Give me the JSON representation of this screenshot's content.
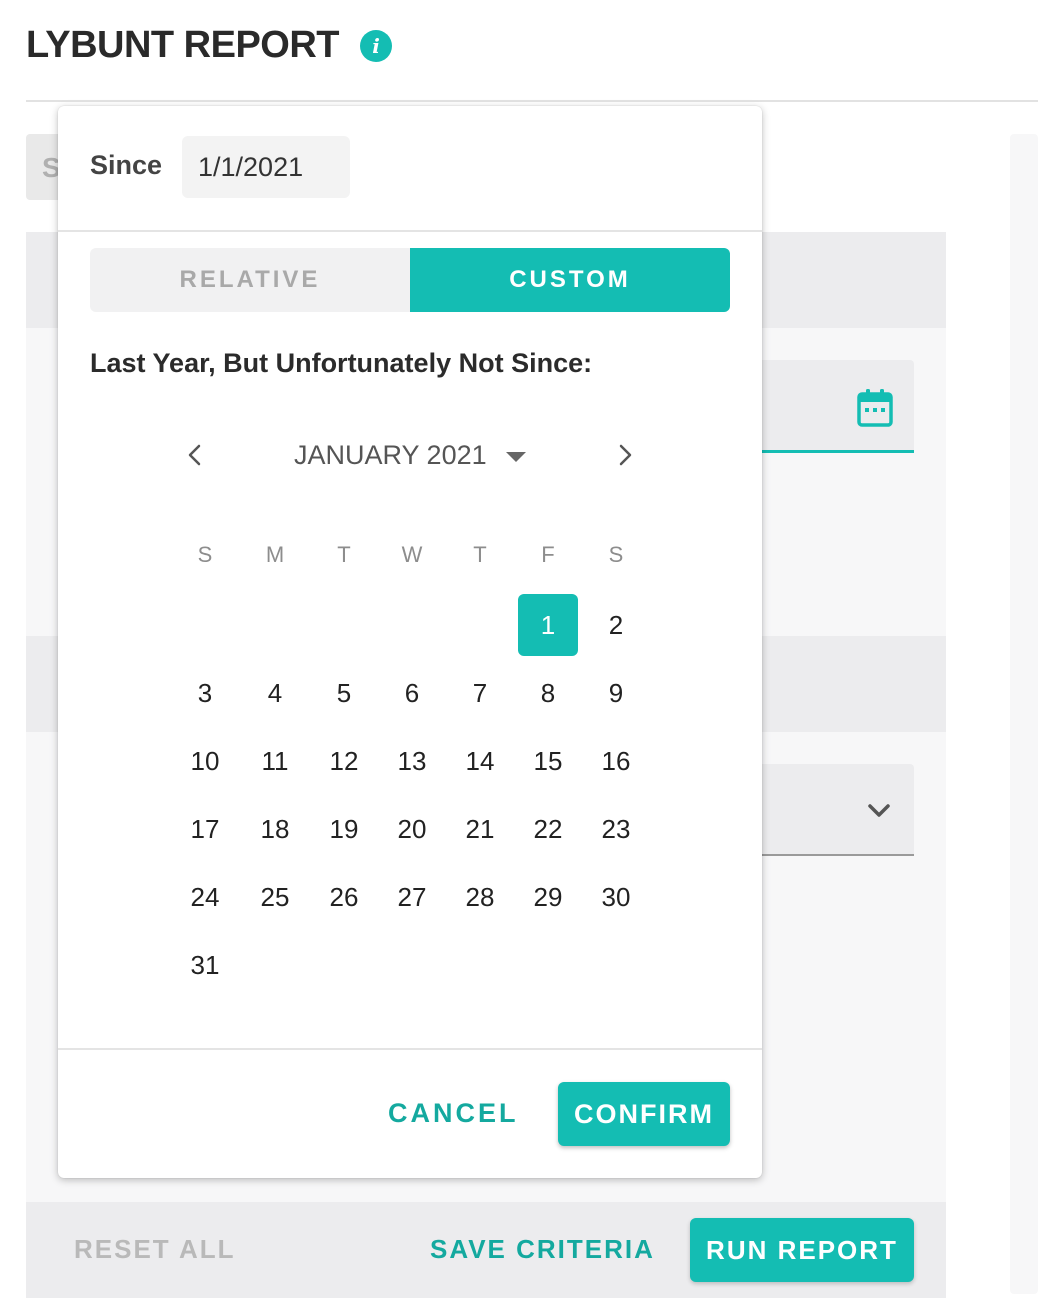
{
  "header": {
    "title": "LYBUNT REPORT",
    "info_icon": "info-icon"
  },
  "background": {
    "chip_letter": "S"
  },
  "popover": {
    "since_label": "Since",
    "since_value": "1/1/2021",
    "tabs": [
      {
        "label": "RELATIVE",
        "active": false
      },
      {
        "label": "CUSTOM",
        "active": true
      }
    ],
    "subheading": "Last Year, But Unfortunately Not Since:",
    "calendar": {
      "month_label": "JANUARY 2021",
      "weekdays": [
        "S",
        "M",
        "T",
        "W",
        "T",
        "F",
        "S"
      ],
      "selected_day": "1",
      "weeks": [
        [
          "",
          "",
          "",
          "",
          "",
          "1",
          "2"
        ],
        [
          "3",
          "4",
          "5",
          "6",
          "7",
          "8",
          "9"
        ],
        [
          "10",
          "11",
          "12",
          "13",
          "14",
          "15",
          "16"
        ],
        [
          "17",
          "18",
          "19",
          "20",
          "21",
          "22",
          "23"
        ],
        [
          "24",
          "25",
          "26",
          "27",
          "28",
          "29",
          "30"
        ],
        [
          "31",
          "",
          "",
          "",
          "",
          "",
          ""
        ]
      ]
    },
    "cancel_label": "CANCEL",
    "confirm_label": "CONFIRM"
  },
  "footer": {
    "reset_label": "RESET ALL",
    "save_label": "SAVE CRITERIA",
    "run_label": "RUN REPORT"
  },
  "colors": {
    "accent": "#14bdb3",
    "accent_text": "#14a99f"
  }
}
